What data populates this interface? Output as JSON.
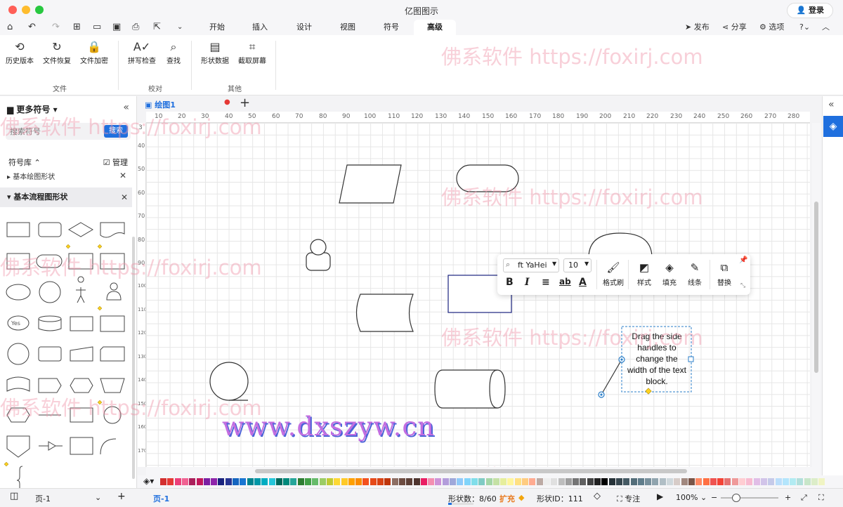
{
  "app": {
    "title": "亿图图示",
    "login_label": "登录"
  },
  "menu": {
    "tabs": [
      "开始",
      "插入",
      "设计",
      "视图",
      "符号",
      "高级"
    ],
    "active_tab": "高级",
    "publish": "发布",
    "share": "分享",
    "options": "选项"
  },
  "ribbon": {
    "buttons": [
      {
        "label": "历史版本",
        "icon": "history-icon"
      },
      {
        "label": "文件恢复",
        "icon": "restore-icon"
      },
      {
        "label": "文件加密",
        "icon": "lock-icon"
      },
      {
        "label": "拼写检查",
        "icon": "spellcheck-icon"
      },
      {
        "label": "查找",
        "icon": "find-icon"
      },
      {
        "label": "形状数据",
        "icon": "shape-data-icon"
      },
      {
        "label": "截取屏幕",
        "icon": "crop-icon"
      }
    ],
    "groups": [
      "文件",
      "校对",
      "其他"
    ]
  },
  "watermark": {
    "text": "佛系软件 https://foxirj.com",
    "site": "www.dxszyw.cn"
  },
  "left_panel": {
    "title": "更多符号",
    "search_placeholder": "搜索符号",
    "search_button": "搜索",
    "library_label": "符号库",
    "manage_label": "管理",
    "library_item_1": "基本绘图形状",
    "library_item_2": "基本流程图形状",
    "thumb_yes": "Yes"
  },
  "document": {
    "tab_name": "绘图1"
  },
  "rulers": {
    "top": [
      "10",
      "20",
      "30",
      "40",
      "50",
      "60",
      "70",
      "80",
      "90",
      "100",
      "110",
      "120",
      "130",
      "140",
      "150",
      "160",
      "170",
      "180",
      "190",
      "200",
      "210",
      "220",
      "230",
      "240",
      "250",
      "260",
      "270",
      "280"
    ],
    "left": [
      "3",
      "40",
      "50",
      "60",
      "70",
      "80",
      "90",
      "100",
      "110",
      "120",
      "130",
      "140",
      "150",
      "160",
      "170"
    ]
  },
  "canvas": {
    "text_block": "Drag the side handles to change the width of the text block."
  },
  "float_toolbar": {
    "font": "ft YaHei",
    "size": "10",
    "format_brush": "格式刷",
    "style": "样式",
    "fill": "填充",
    "line": "线条",
    "replace": "替换"
  },
  "colors": {
    "accent": "#1f6fde",
    "palette": [
      "#d32f2f",
      "#e53935",
      "#ec407a",
      "#f06292",
      "#ab1f5b",
      "#c2185b",
      "#7b1fa2",
      "#8e24aa",
      "#1a237e",
      "#283593",
      "#1565c0",
      "#1976d2",
      "#00838f",
      "#0097a7",
      "#00acc1",
      "#26c6da",
      "#00695c",
      "#00897b",
      "#26a69a",
      "#2e7d32",
      "#43a047",
      "#66bb6a",
      "#9ccc65",
      "#c0ca33",
      "#fdd835",
      "#ffca28",
      "#ffa000",
      "#fb8c00",
      "#f4511e",
      "#e64a19",
      "#d84315",
      "#bf360c",
      "#8d6e63",
      "#6d4c41",
      "#5d4037",
      "#4e342e",
      "#e91e63",
      "#f48fb1",
      "#ce93d8",
      "#b39ddb",
      "#9fa8da",
      "#90caf9",
      "#81d4fa",
      "#80deea",
      "#80cbc4",
      "#a5d6a7",
      "#c5e1a5",
      "#e6ee9c",
      "#fff59d",
      "#ffe082",
      "#ffcc80",
      "#ffab91",
      "#bcaaa4",
      "#eeeeee",
      "#e0e0e0",
      "#bdbdbd",
      "#9e9e9e",
      "#757575",
      "#616161",
      "#424242",
      "#212121",
      "#000000",
      "#263238",
      "#37474f",
      "#455a64",
      "#546e7a",
      "#607d8b",
      "#78909c",
      "#90a4ae",
      "#b0bec5",
      "#cfd8dc",
      "#d7ccc8",
      "#a1887f",
      "#795548",
      "#ff8a65",
      "#ff7043",
      "#ef5350",
      "#f44336",
      "#e57373",
      "#ef9a9a",
      "#ffcdd2",
      "#f8bbd0",
      "#e1bee7",
      "#d1c4e9",
      "#c5cae9",
      "#bbdefb",
      "#b3e5fc",
      "#b2ebf2",
      "#b2dfdb",
      "#c8e6c9",
      "#dcedc8",
      "#f0f4c3"
    ]
  },
  "status": {
    "page_name": "页-1",
    "page_tab": "页-1",
    "shape_count": "形状数：8/60",
    "expand": "扩充",
    "shape_id": "形状ID：111",
    "focus": "专注",
    "zoom": "100%"
  }
}
